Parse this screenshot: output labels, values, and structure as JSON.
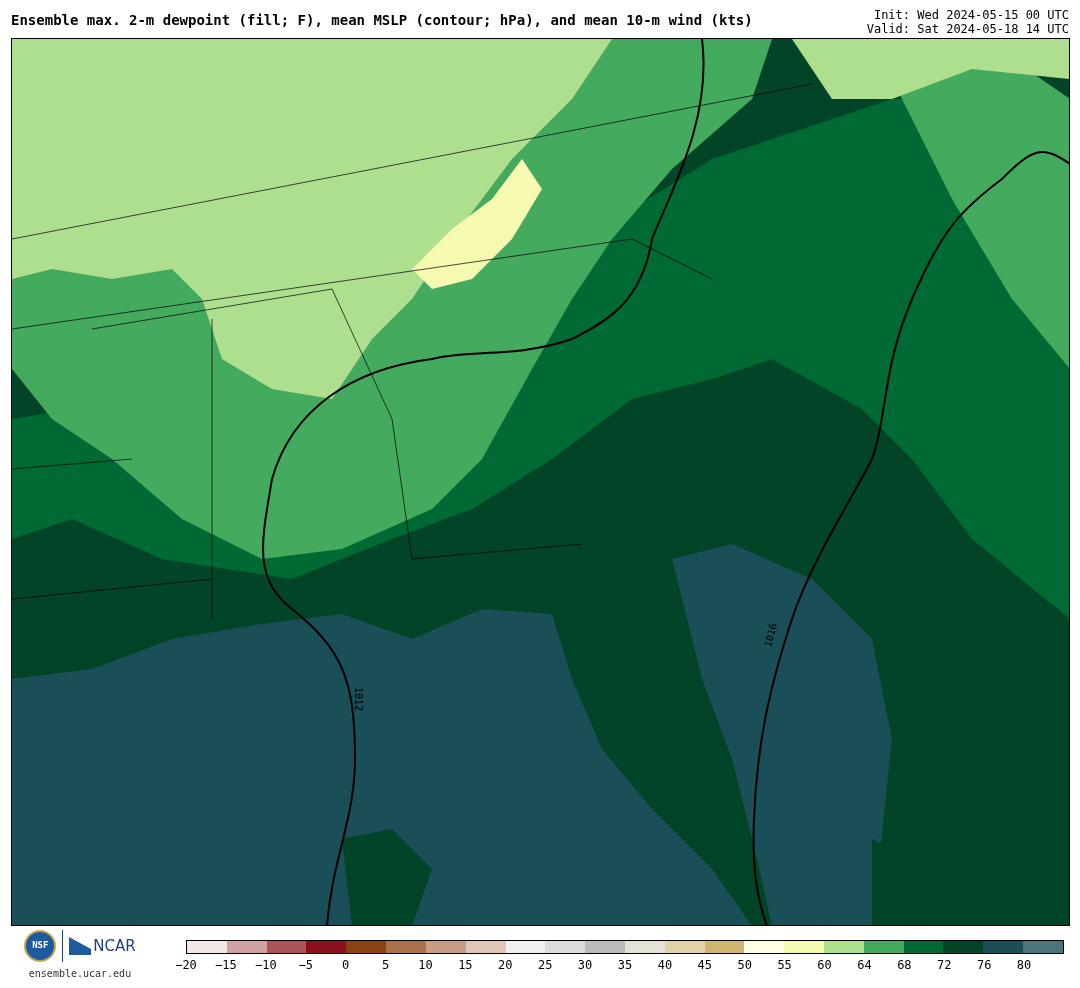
{
  "header": {
    "title": "Ensemble max. 2-m dewpoint (fill; F), mean MSLP (contour; hPa), and mean 10-m wind (kts)",
    "init": "Init: Wed 2024-05-15 00 UTC",
    "valid": "Valid: Sat 2024-05-18 14 UTC"
  },
  "map": {
    "contours": [
      {
        "label": "1012"
      },
      {
        "label": "1016"
      }
    ]
  },
  "footer": {
    "nsf_logo": "NSF",
    "ncar_logo": "NCAR",
    "site": "ensemble.ucar.edu"
  },
  "colorbar": {
    "segments": [
      {
        "color": "#f3e6e6"
      },
      {
        "color": "#d1a0a3"
      },
      {
        "color": "#ac5358"
      },
      {
        "color": "#8b101e"
      },
      {
        "color": "#8a4214"
      },
      {
        "color": "#aa704b"
      },
      {
        "color": "#c69d82"
      },
      {
        "color": "#e0c6b6"
      },
      {
        "color": "#f0f0ef"
      },
      {
        "color": "#dcdcdc"
      },
      {
        "color": "#bbbbbb"
      },
      {
        "color": "#e3e4d5"
      },
      {
        "color": "#e2d2a9"
      },
      {
        "color": "#cfb56f"
      },
      {
        "color": "#fefee0"
      },
      {
        "color": "#f6f9b0"
      },
      {
        "color": "#addf8e"
      },
      {
        "color": "#44ab5e"
      },
      {
        "color": "#006a35"
      },
      {
        "color": "#024428"
      },
      {
        "color": "#1a4f57"
      },
      {
        "color": "#4b7578"
      }
    ],
    "ticks": [
      "−20",
      "−15",
      "−10",
      "−5",
      "0",
      "5",
      "10",
      "15",
      "20",
      "25",
      "30",
      "35",
      "40",
      "45",
      "50",
      "55",
      "60",
      "64",
      "68",
      "72",
      "76",
      "80"
    ]
  }
}
